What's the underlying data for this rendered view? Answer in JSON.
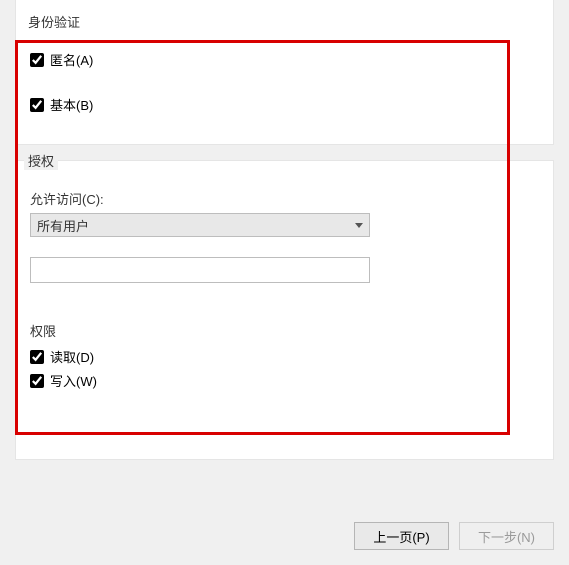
{
  "authentication": {
    "legend": "身份验证",
    "anonymous": {
      "label": "匿名(A)",
      "checked": true
    },
    "basic": {
      "label": "基本(B)",
      "checked": true
    }
  },
  "authorization": {
    "legend": "授权",
    "allow_access_label": "允许访问(C):",
    "allow_access_selected": "所有用户",
    "specific_value": "",
    "permissions": {
      "legend": "权限",
      "read": {
        "label": "读取(D)",
        "checked": true
      },
      "write": {
        "label": "写入(W)",
        "checked": true
      }
    }
  },
  "buttons": {
    "prev": "上一页(P)",
    "next": "下一步(N)"
  }
}
